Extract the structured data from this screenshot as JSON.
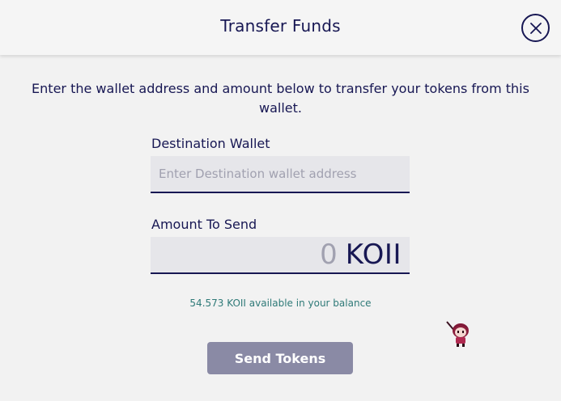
{
  "header": {
    "title": "Transfer Funds",
    "close_icon": "close-icon"
  },
  "description": "Enter the wallet address and amount below to transfer your tokens from this wallet.",
  "destination": {
    "label": "Destination Wallet",
    "value": "",
    "placeholder": "Enter Destination wallet address"
  },
  "amount": {
    "label": "Amount To Send",
    "value": "0",
    "unit": "KOII"
  },
  "balance_text": "54.573 KOII available in your balance",
  "send_button": {
    "label": "Send Tokens"
  },
  "colors": {
    "primary": "#171753",
    "input_bg": "#e6e6ea",
    "button_bg": "#8a8aa5",
    "balance_text": "#2f7a78",
    "background": "#f2f2f2"
  },
  "icons": [
    "close-icon",
    "mascot-icon"
  ]
}
